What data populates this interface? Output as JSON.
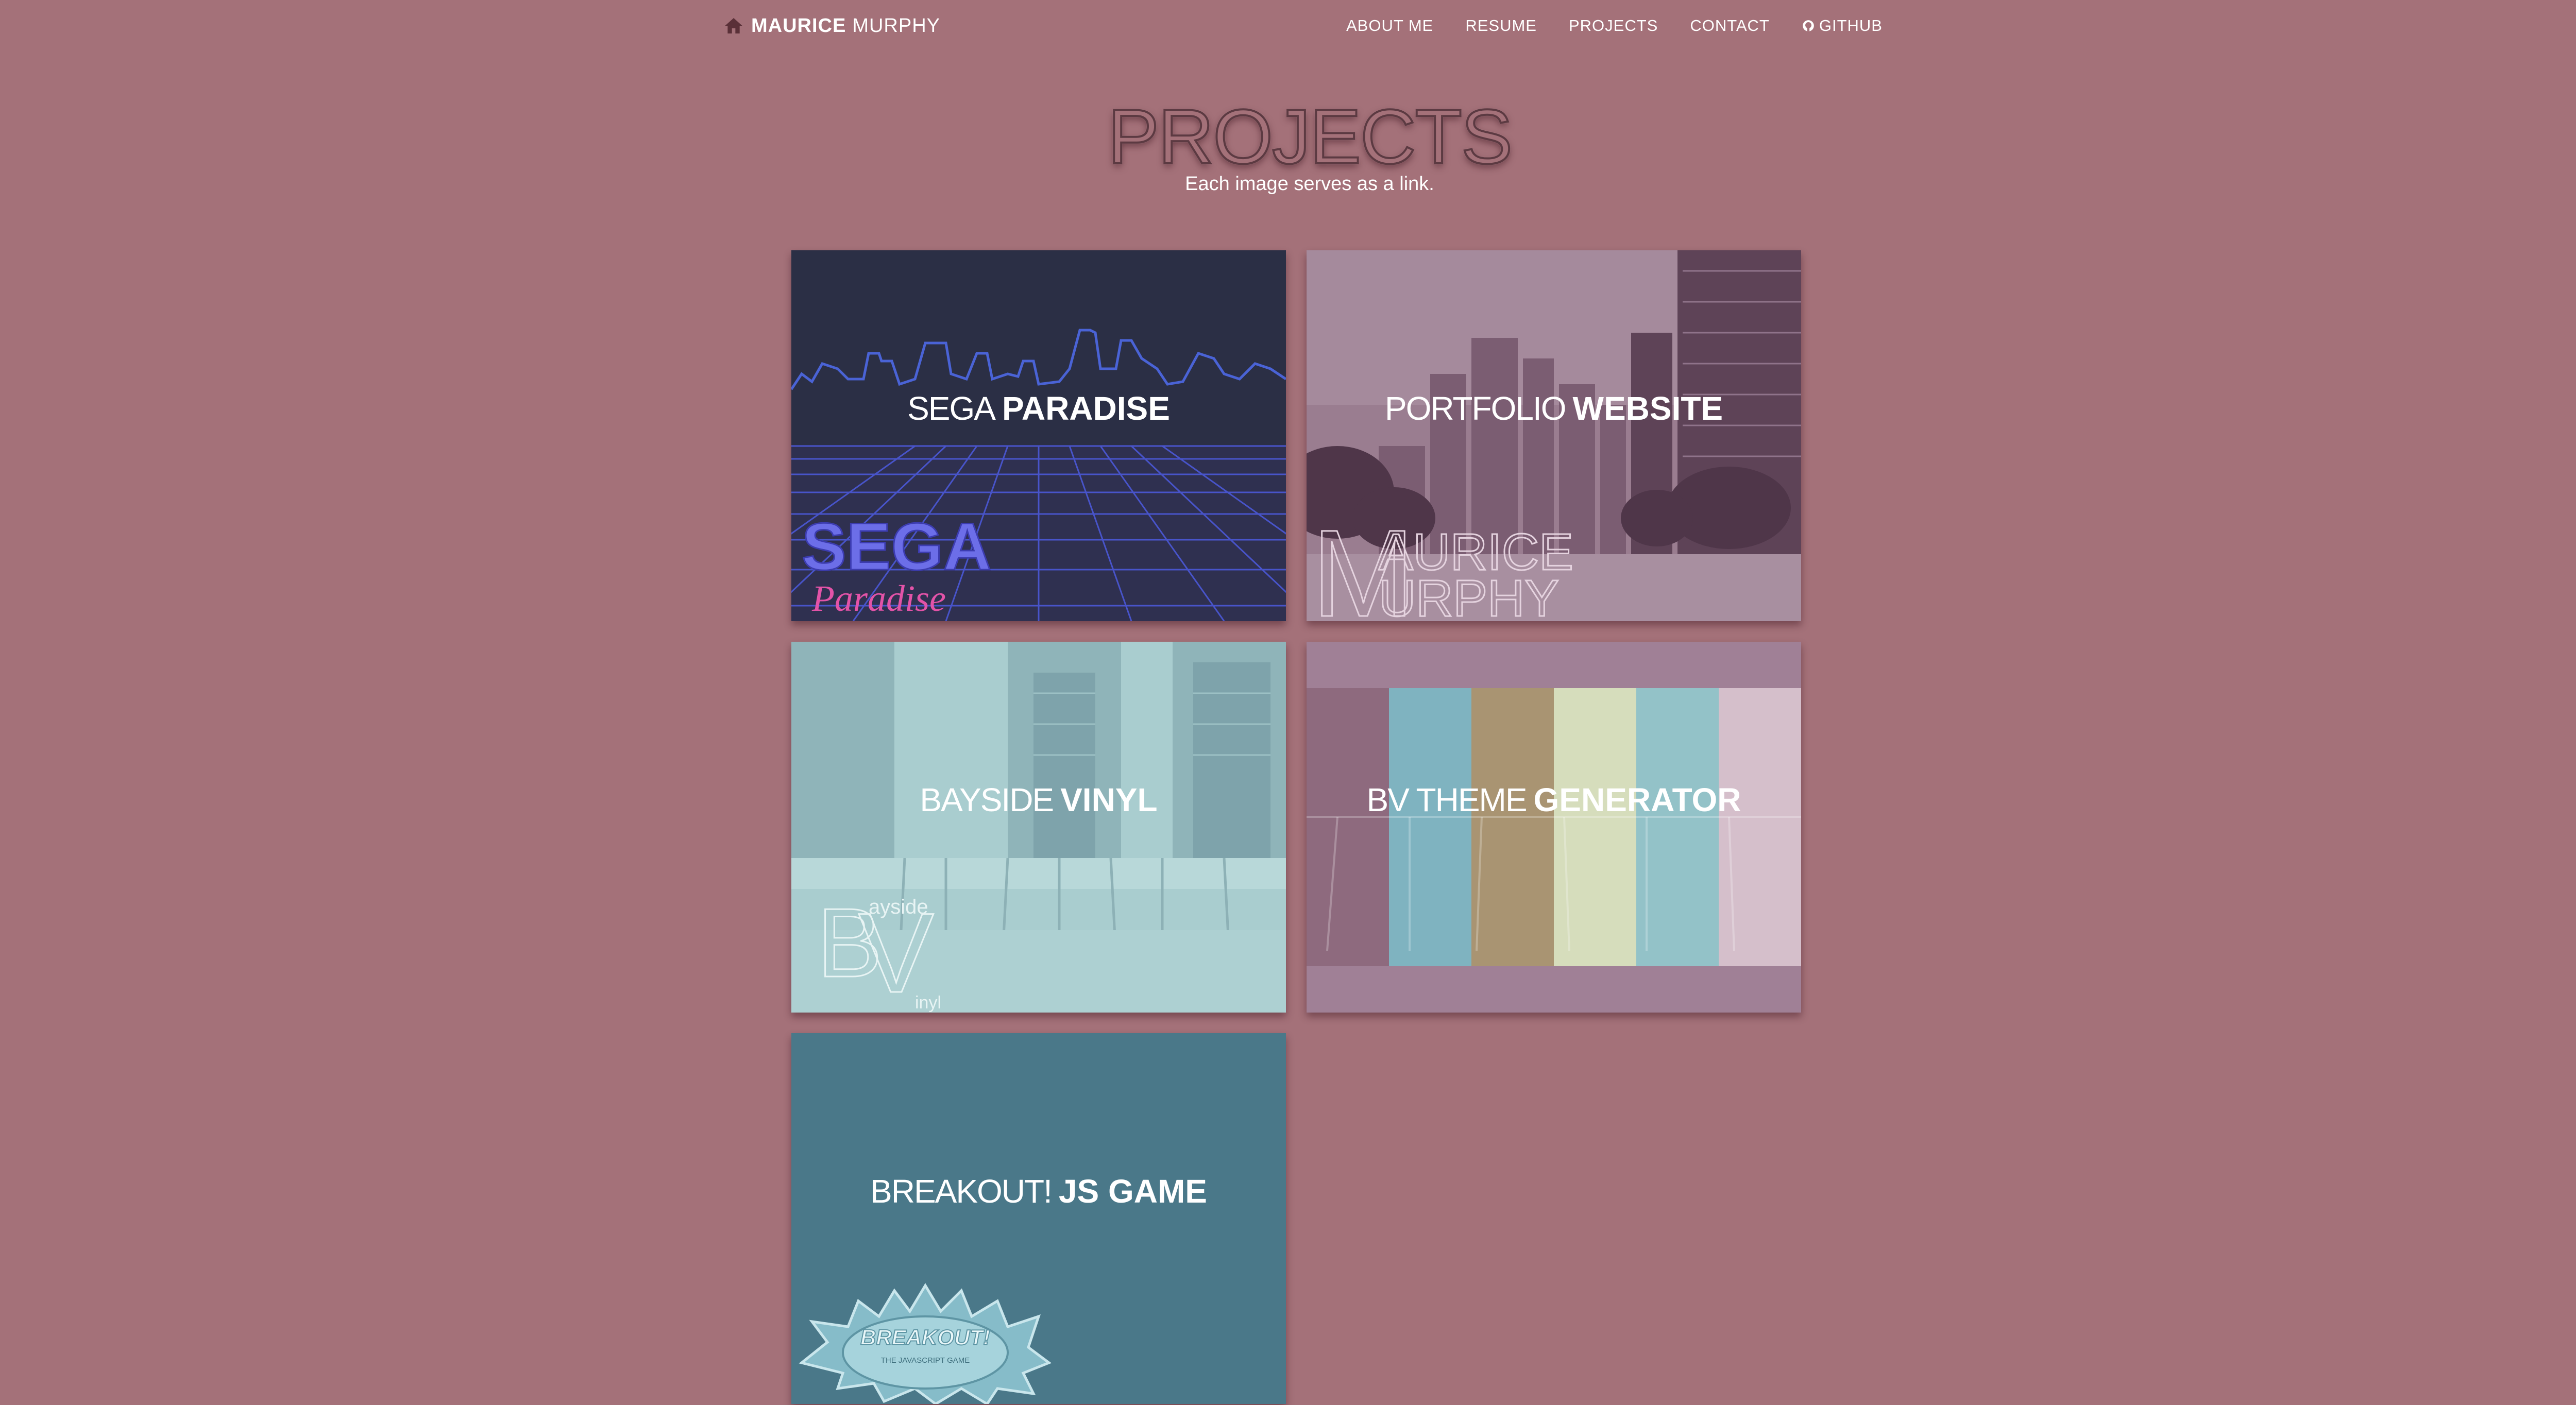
{
  "nav": {
    "brand_first": "MAURICE",
    "brand_last": "MURPHY",
    "links": [
      "ABOUT ME",
      "RESUME",
      "PROJECTS",
      "CONTACT",
      "GITHUB"
    ],
    "home_icon": "home-icon",
    "github_icon": "github-icon"
  },
  "header": {
    "title": "PROJECTS",
    "subtitle": "Each image serves as a link."
  },
  "projects": [
    {
      "light": "SEGA",
      "bold": "PARADISE",
      "logo_line1": "SEGA",
      "logo_line2": "Paradise"
    },
    {
      "light": "PORTFOLIO",
      "bold": "WEBSITE",
      "logo_line1": "AURICE",
      "logo_line2": "URPHY"
    },
    {
      "light": "BAYSIDE",
      "bold": "VINYL",
      "logo_line1": "ayside",
      "logo_line2": "inyl"
    },
    {
      "light": "BV THEME",
      "bold": "GENERATOR"
    },
    {
      "light": "BREAKOUT!",
      "bold": "JS GAME",
      "logo_line1": "BREAKOUT!",
      "logo_line2": "THE JAVASCRIPT GAME"
    }
  ],
  "colors": {
    "page_bg": "#a47179",
    "sega_bg": "#2b2f45",
    "portfolio_bg": "#8d6d84",
    "vinyl_bg": "#a9cdcf",
    "bv_bg": "#a08096",
    "breakout_bg": "#4a7889"
  }
}
